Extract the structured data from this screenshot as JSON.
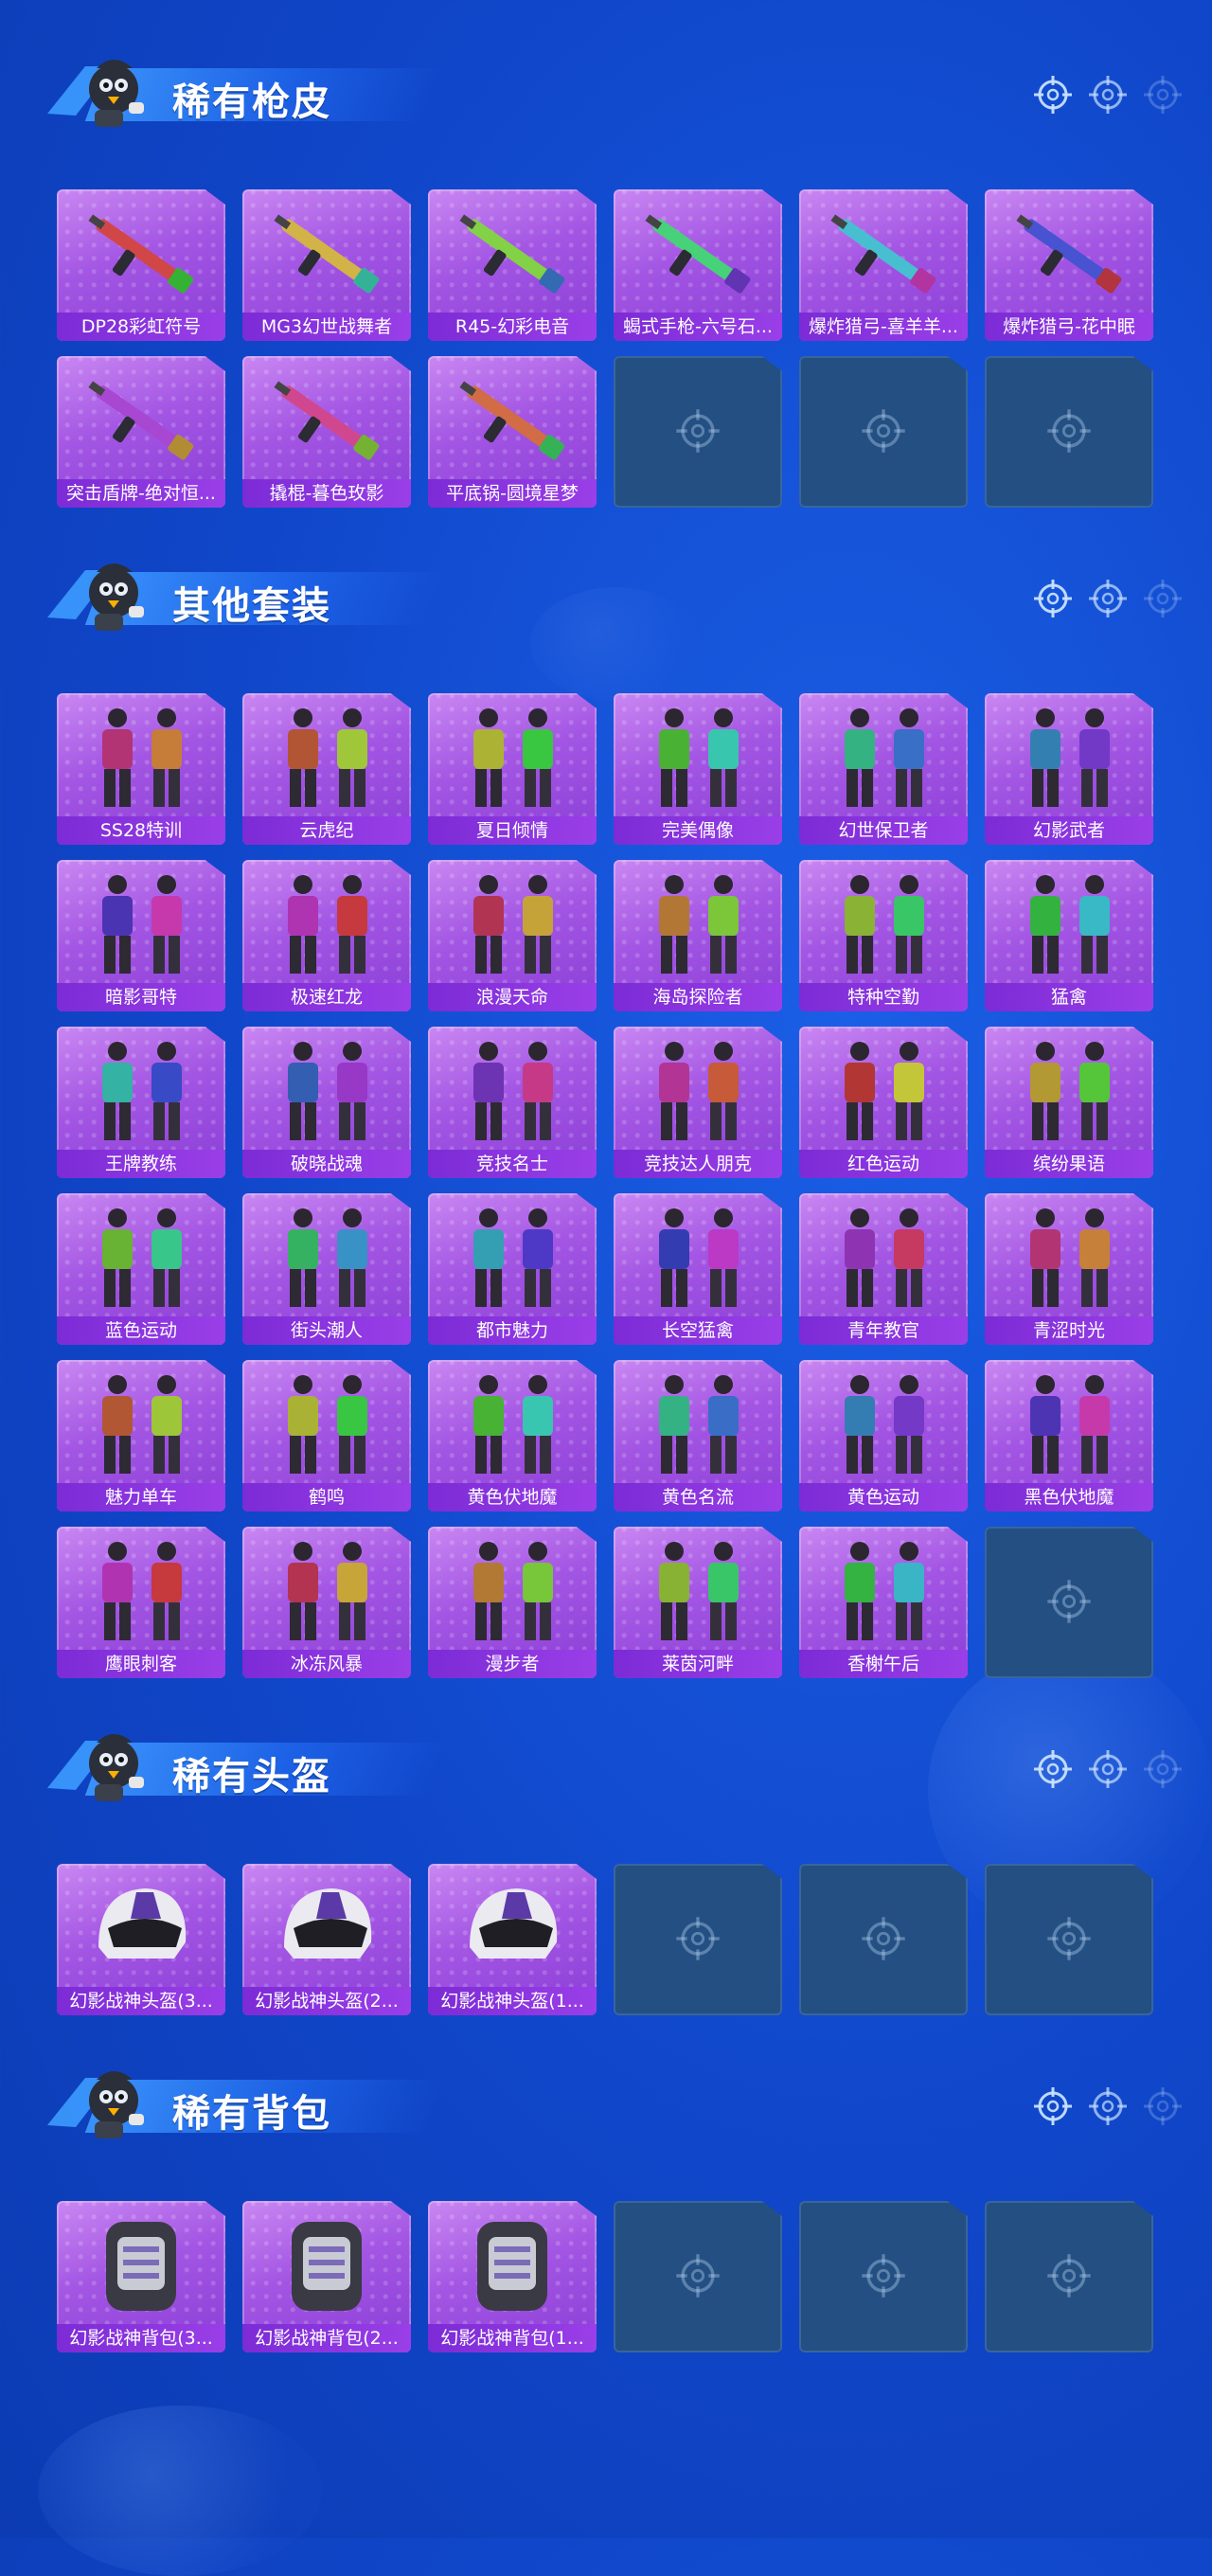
{
  "colors": {
    "background": "#1046c9",
    "card_purple": "#a355e3",
    "label_purple": "#8a35de",
    "empty_slot": "#234f82"
  },
  "sections": [
    {
      "title": "稀有枪皮",
      "items": [
        "DP28彩虹符号",
        "MG3幻世战舞者",
        "R45-幻彩电音",
        "蝎式手枪-六号石...",
        "爆炸猎弓-喜羊羊...",
        "爆炸猎弓-花中眠",
        "突击盾牌-绝对恒...",
        "撬棍-暮色玫影",
        "平底锅-圆境星梦"
      ],
      "empty_slots": 3
    },
    {
      "title": "其他套装",
      "items": [
        "SS28特训",
        "云虎纪",
        "夏日倾情",
        "完美偶像",
        "幻世保卫者",
        "幻影武者",
        "暗影哥特",
        "极速红龙",
        "浪漫天命",
        "海岛探险者",
        "特种空勤",
        "猛禽",
        "王牌教练",
        "破晓战魂",
        "竞技名士",
        "竞技达人朋克",
        "红色运动",
        "缤纷果语",
        "蓝色运动",
        "街头潮人",
        "都市魅力",
        "长空猛禽",
        "青年教官",
        "青涩时光",
        "魅力单车",
        "鹤鸣",
        "黄色伏地魔",
        "黄色名流",
        "黄色运动",
        "黑色伏地魔",
        "鹰眼刺客",
        "冰冻风暴",
        "漫步者",
        "莱茵河畔",
        "香榭午后"
      ],
      "empty_slots": 1
    },
    {
      "title": "稀有头盔",
      "items": [
        "幻影战神头盔(3...",
        "幻影战神头盔(2...",
        "幻影战神头盔(1..."
      ],
      "empty_slots": 3
    },
    {
      "title": "稀有背包",
      "items": [
        "幻影战神背包(3...",
        "幻影战神背包(2...",
        "幻影战神背包(1..."
      ],
      "empty_slots": 3
    }
  ]
}
